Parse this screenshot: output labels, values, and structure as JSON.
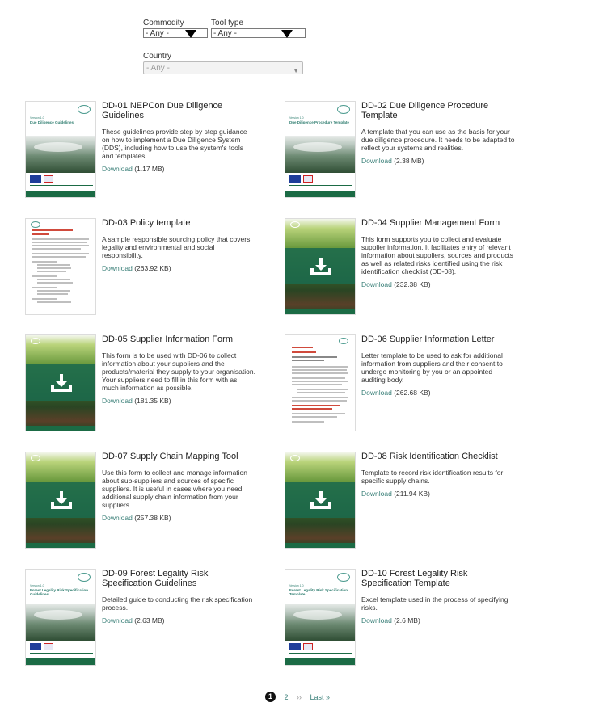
{
  "filters": {
    "commodity": {
      "label": "Commodity",
      "value": "- Any -"
    },
    "tool_type": {
      "label": "Tool type",
      "value": "- Any -"
    },
    "country": {
      "label": "Country",
      "value": "- Any -"
    }
  },
  "items": [
    {
      "title": "DD-01 NEPCon Due Diligence Guidelines",
      "description": "These guidelines provide step by step guidance on how to implement a Due Diligence System (DDS), including how to use the system's tools and templates.",
      "download_label": "Download",
      "size": "(1.17 MB)",
      "cover_sub": "Version 1.0",
      "cover_title": "Due Diligence Guidelines"
    },
    {
      "title": "DD-02 Due Diligence Procedure Template",
      "description": "A template that you can use as the basis for your due diligence procedure. It needs to be adapted to reflect your systems and realities.",
      "download_label": "Download",
      "size": "(2.38 MB)",
      "cover_sub": "Version 1.0",
      "cover_title": "Due Diligence Procedure Template"
    },
    {
      "title": "DD-03 Policy template",
      "description": "A sample responsible sourcing policy that covers legality and environmental and social responsibility.",
      "download_label": "Download",
      "size": "(263.92 KB)"
    },
    {
      "title": "DD-04 Supplier Management Form",
      "description": "This form supports you to collect and evaluate supplier information. It facilitates entry of relevant information about suppliers, sources and products as well as related risks identified using the risk identification checklist (DD-08).",
      "download_label": "Download",
      "size": "(232.38 KB)"
    },
    {
      "title": "DD-05 Supplier Information Form",
      "description": "This form is to be used with DD-06 to collect information about your suppliers and the products/material they supply to your organisation. Your suppliers need to fill in this form with as much information as possible.",
      "download_label": "Download",
      "size": "(181.35 KB)"
    },
    {
      "title": "DD-06 Supplier Information Letter",
      "description": "Letter template to be used to ask for additional information from suppliers and their consent to undergo monitoring by you or an appointed auditing body.",
      "download_label": "Download",
      "size": "(262.68 KB)"
    },
    {
      "title": "DD-07 Supply Chain Mapping Tool",
      "description": "Use this form to collect and manage information about sub-suppliers and sources of specific suppliers. It is useful in cases where you need additional supply chain information from your suppliers.",
      "download_label": "Download",
      "size": "(257.38 KB)"
    },
    {
      "title": "DD-08 Risk Identification Checklist",
      "description": "Template to record risk identification results for specific supply chains.",
      "download_label": "Download",
      "size": "(211.94 KB)"
    },
    {
      "title": "DD-09 Forest Legality Risk Specification Guidelines",
      "description": "Detailed guide to conducting the risk specification process.",
      "download_label": "Download",
      "size": "(2.63 MB)",
      "cover_sub": "Version 1.0",
      "cover_title": "Forest Legality Risk Specification Guidelines"
    },
    {
      "title": "DD-10 Forest Legality Risk Specification Template",
      "description": "Excel template used in the process of specifying risks.",
      "download_label": "Download",
      "size": "(2.6 MB)",
      "cover_sub": "Version 1.0",
      "cover_title": "Forest Legality Risk Specification Template"
    }
  ],
  "pager": {
    "current": "1",
    "next_page": "2",
    "next": "››",
    "last": "Last »"
  },
  "colors": {
    "link": "#3b8079",
    "brand_green": "#1b6b45"
  },
  "icons": {
    "download": "download-icon",
    "dropdown": "chevron-down-icon"
  }
}
